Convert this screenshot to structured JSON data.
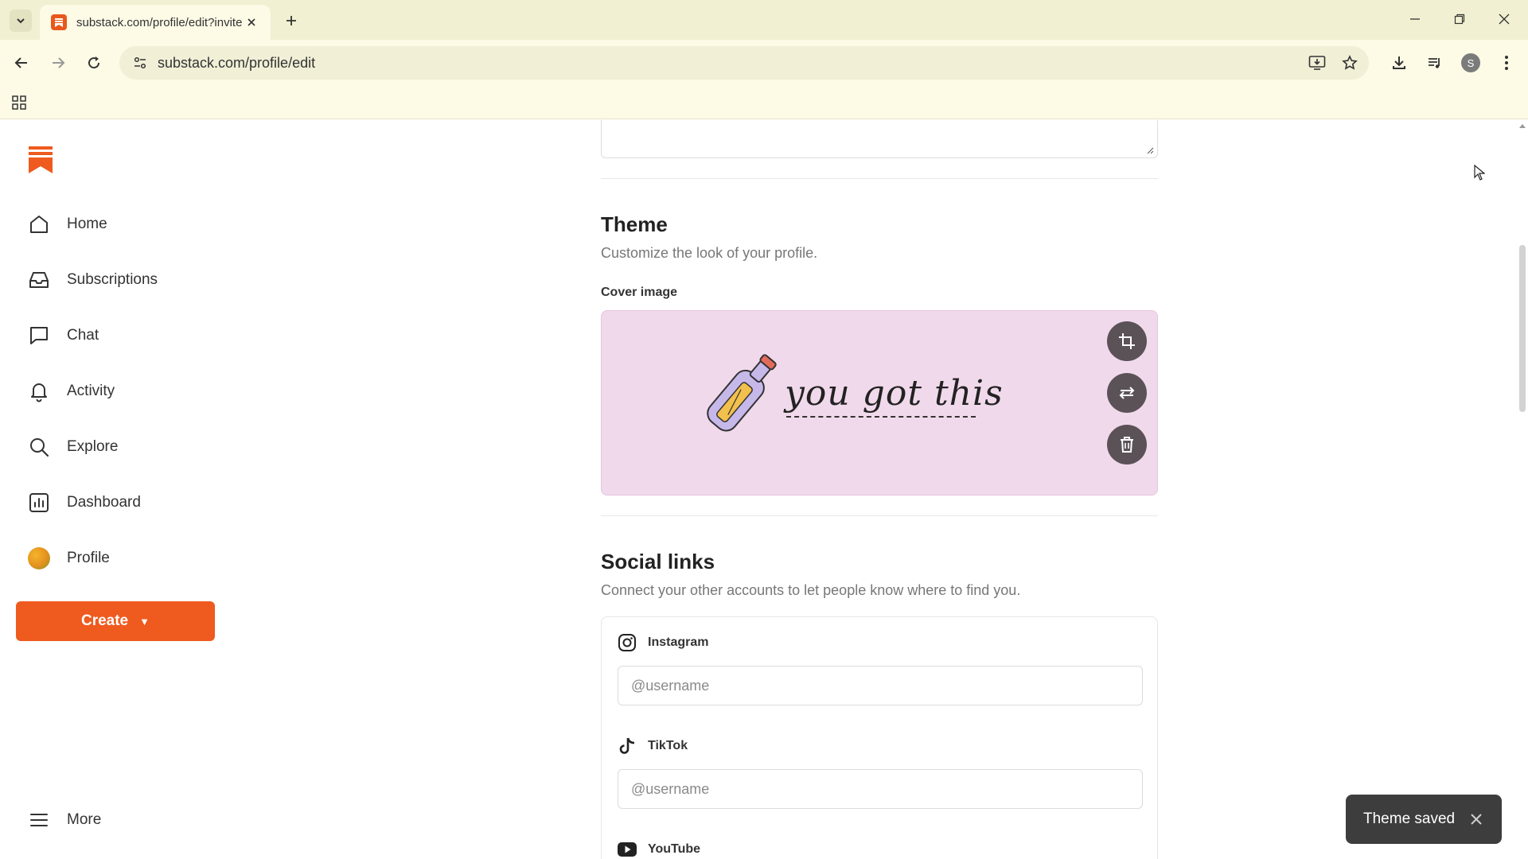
{
  "browser": {
    "tab": {
      "title": "substack.com/profile/edit?invite"
    },
    "url": "substack.com/profile/edit",
    "profile_initial": "S"
  },
  "sidebar": {
    "items": [
      {
        "label": "Home",
        "icon": "home-icon"
      },
      {
        "label": "Subscriptions",
        "icon": "inbox-icon"
      },
      {
        "label": "Chat",
        "icon": "chat-bubble-icon"
      },
      {
        "label": "Activity",
        "icon": "bell-icon"
      },
      {
        "label": "Explore",
        "icon": "search-icon"
      },
      {
        "label": "Dashboard",
        "icon": "bar-chart-icon"
      },
      {
        "label": "Profile",
        "icon": "avatar"
      }
    ],
    "create_label": "Create",
    "more_label": "More"
  },
  "theme": {
    "title": "Theme",
    "subtitle": "Customize the look of your profile.",
    "cover_label": "Cover image",
    "cover_text": "you got this"
  },
  "social": {
    "title": "Social links",
    "subtitle": "Connect your other accounts to let people know where to find you.",
    "links": [
      {
        "label": "Instagram",
        "placeholder": "@username"
      },
      {
        "label": "TikTok",
        "placeholder": "@username"
      },
      {
        "label": "YouTube"
      }
    ]
  },
  "toast": {
    "message": "Theme saved"
  },
  "colors": {
    "brand": "#ef5a1e",
    "cover_bg": "#f1d9ec",
    "chrome_bg": "#fdfae6"
  }
}
